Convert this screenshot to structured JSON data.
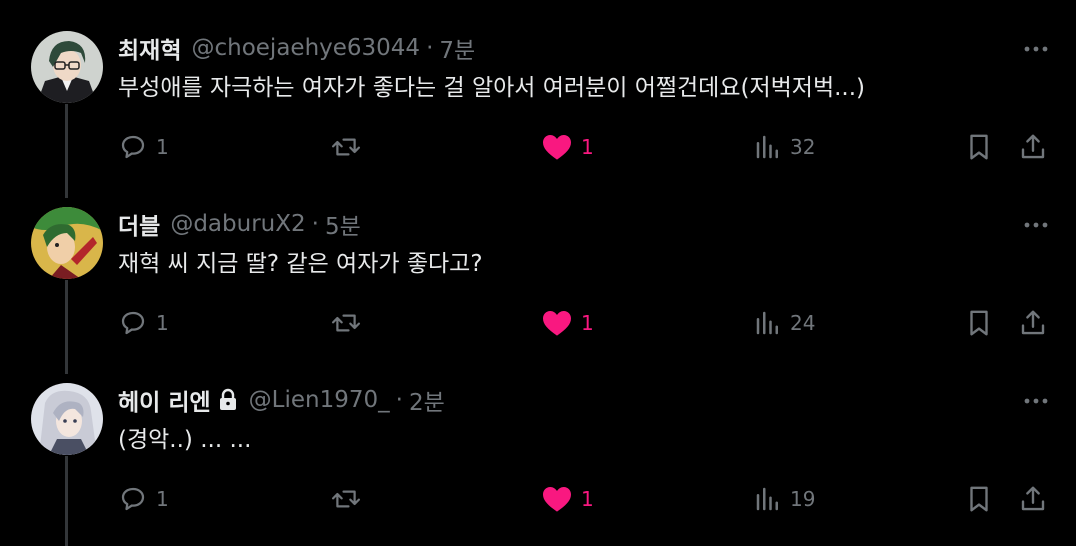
{
  "colors": {
    "background": "#000000",
    "primary_text": "#e7e9ea",
    "secondary_text": "#71767b",
    "like_active": "#f91880",
    "thread_line": "#333639"
  },
  "tweets": [
    {
      "name": "최재혁",
      "protected": false,
      "handle": "@choejaehye63044",
      "separator": "·",
      "time": "7분",
      "text": "부성애를 자극하는 여자가 좋다는 걸 알아서 여러분이 어쩔건데요(저벅저벅...)",
      "replies": "1",
      "retweets": "",
      "likes": "1",
      "liked": true,
      "views": "32"
    },
    {
      "name": "더블",
      "protected": false,
      "handle": "@daburuX2",
      "separator": "·",
      "time": "5분",
      "text": "재혁 씨 지금 딸? 같은 여자가 좋다고?",
      "replies": "1",
      "retweets": "",
      "likes": "1",
      "liked": true,
      "views": "24"
    },
    {
      "name": "헤이 리엔",
      "protected": true,
      "handle": "@Lien1970_",
      "separator": "·",
      "time": "2분",
      "text": "(경악..) ... ...",
      "replies": "1",
      "retweets": "",
      "likes": "1",
      "liked": true,
      "views": "19"
    }
  ],
  "icons": {
    "more": "more-horizontal-icon",
    "reply": "reply-bubble-icon",
    "retweet": "retweet-icon",
    "like": "heart-filled-icon",
    "views": "views-bar-chart-icon",
    "bookmark": "bookmark-icon",
    "share": "share-upload-icon",
    "lock": "lock-icon"
  }
}
